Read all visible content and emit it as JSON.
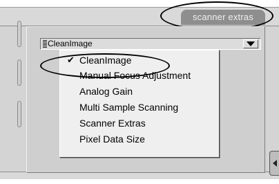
{
  "tab": {
    "label": "scanner extras"
  },
  "dropdown": {
    "value": "CleanImage"
  },
  "menu": {
    "items": [
      {
        "label": "CleanImage",
        "checked": true
      },
      {
        "label": "Manual Focus Adjustment",
        "checked": false
      },
      {
        "label": "Analog Gain",
        "checked": false
      },
      {
        "label": "Multi Sample Scanning",
        "checked": false
      },
      {
        "label": "Scanner Extras",
        "checked": false
      },
      {
        "label": "Pixel Data Size",
        "checked": false
      }
    ],
    "check_glyph": "✔"
  },
  "icons": {
    "dropdown_arrow": "chevron-down-icon",
    "grip": "grip-icon",
    "collapse": "chevron-left-icon"
  }
}
